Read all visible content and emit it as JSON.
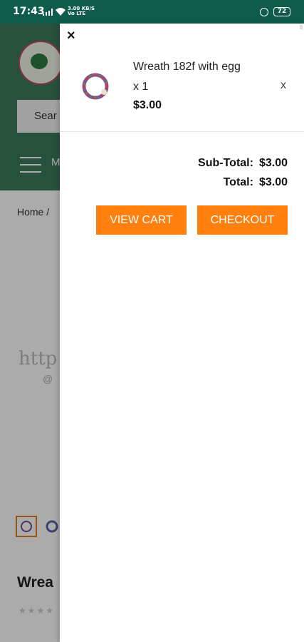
{
  "status_bar": {
    "time": "17:43",
    "speed": "3.00 KB/S",
    "net": "Vo LTE",
    "battery": "72"
  },
  "background": {
    "search_placeholder": "Sear",
    "menu_label": "M",
    "breadcrumb": "Home  /",
    "watermark": "http",
    "watermark_sub": "@",
    "product_title": "Wrea",
    "stars": "★★★★"
  },
  "cart": {
    "close_label": "×",
    "item": {
      "name": "Wreath 182f with egg",
      "qty": "x 1",
      "price": "$3.00",
      "remove_label": "x"
    },
    "subtotal_label": "Sub-Total:",
    "subtotal_value": "$3.00",
    "total_label": "Total:",
    "total_value": "$3.00",
    "view_cart_label": "VIEW CART",
    "checkout_label": "CHECKOUT"
  },
  "colors": {
    "status_bar": "#0f5c4a",
    "header_green": "#3d7a5c",
    "button_orange": "#ff7f0f"
  }
}
